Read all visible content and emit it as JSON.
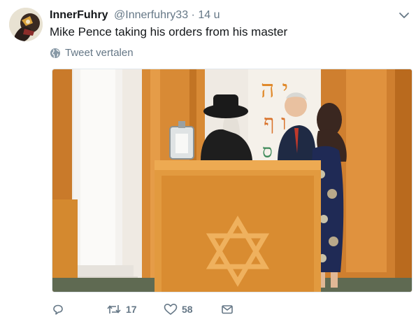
{
  "tweet": {
    "display_name": "InnerFuhry",
    "handle": "@Innerfuhry33",
    "separator": "·",
    "time": "14 u",
    "text": "Mike Pence taking his orders from his master",
    "translate_label": "Tweet vertalen"
  },
  "media": {
    "description_icon": "photo"
  },
  "actions": {
    "reply_count": "",
    "retweet_count": "17",
    "like_count": "58"
  },
  "colors": {
    "text": "#14171a",
    "secondary": "#657786"
  }
}
